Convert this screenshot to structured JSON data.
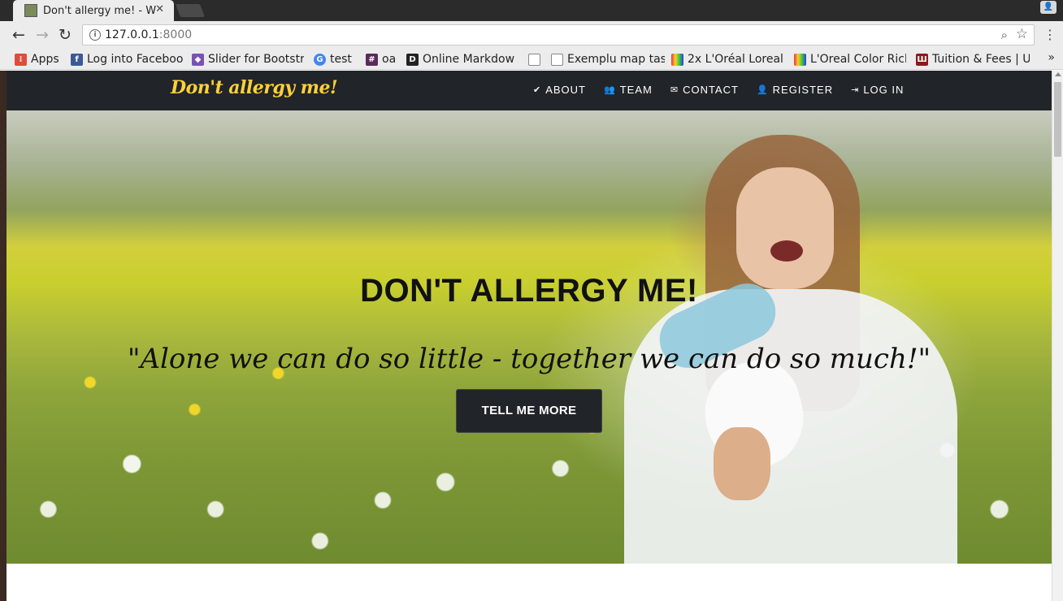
{
  "browser": {
    "tab": {
      "title": "Don't allergy me! - W",
      "close_glyph": "✕"
    },
    "address": {
      "host": "127.0.0.1",
      "port": ":8000"
    },
    "bookmarks": [
      {
        "label": "Apps",
        "icon": "apps-grid-icon",
        "color": "#e04b3a"
      },
      {
        "label": "Log into Faceboo",
        "icon": "facebook-icon",
        "color": "#3b5998"
      },
      {
        "label": "Slider for Bootstr",
        "icon": "bootstrap-icon",
        "color": "#7952b3"
      },
      {
        "label": "test",
        "icon": "google-icon",
        "color": "#4285f4"
      },
      {
        "label": "oa",
        "icon": "hash-icon",
        "color": "#5a2a5a"
      },
      {
        "label": "Online Markdow",
        "icon": "d-icon",
        "color": "#222222"
      },
      {
        "label": "",
        "icon": "file-icon",
        "color": "#ffffff"
      },
      {
        "label": "Exemplu map tas",
        "icon": "file-icon",
        "color": "#ffffff"
      },
      {
        "label": "2x L'Oréal Loreal",
        "icon": "tv-icon",
        "color": "#2a2a6a"
      },
      {
        "label": "L'Oreal Color Rich",
        "icon": "tv-icon",
        "color": "#2a2a6a"
      },
      {
        "label": "Tuition & Fees | U",
        "icon": "university-icon",
        "color": "#8b1a1a"
      }
    ],
    "more_glyph": "»"
  },
  "site": {
    "brand": "Don't allergy me!",
    "nav": [
      {
        "label": "ABOUT",
        "icon": "check-icon",
        "glyph": "✔"
      },
      {
        "label": "TEAM",
        "icon": "users-icon",
        "glyph": "👥"
      },
      {
        "label": "CONTACT",
        "icon": "envelope-icon",
        "glyph": "✉"
      },
      {
        "label": "REGISTER",
        "icon": "user-icon",
        "glyph": "👤"
      },
      {
        "label": "LOG IN",
        "icon": "sign-in-icon",
        "glyph": "⇥"
      }
    ],
    "hero": {
      "heading": "DON'T ALLERGY ME!",
      "quote": "\"Alone we can do so little - together we can do so much!\"",
      "button": "TELL ME MORE"
    },
    "colors": {
      "navbar": "#212529",
      "brand": "#fed136",
      "button": "#212529"
    }
  }
}
